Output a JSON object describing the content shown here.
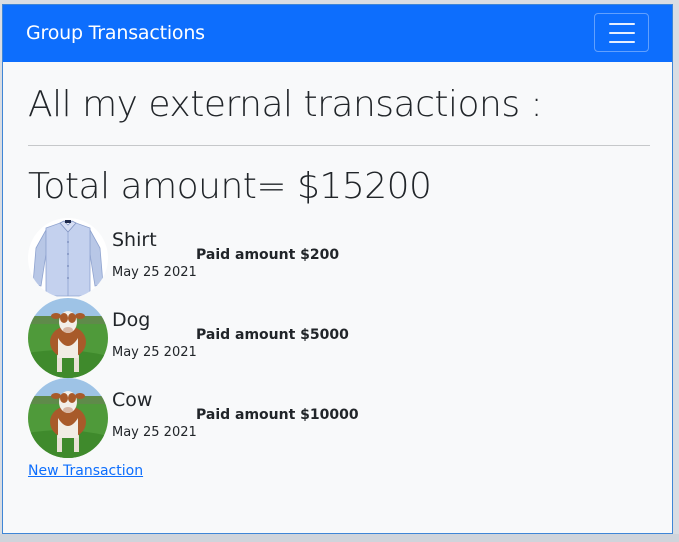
{
  "navbar": {
    "brand": "Group Transactions",
    "toggle_icon": "hamburger-menu-icon",
    "color": "#0d6efd"
  },
  "page": {
    "title": "All my external transactions :",
    "total": "Total amount= $15200"
  },
  "transactions": [
    {
      "name": "Shirt",
      "date": "May 25 2021",
      "paid": "Paid amount $200",
      "image": "shirt-photo"
    },
    {
      "name": "Dog",
      "date": "May 25 2021",
      "paid": "Paid amount $5000",
      "image": "cow-photo"
    },
    {
      "name": "Cow",
      "date": "May 25 2021",
      "paid": "Paid amount $10000",
      "image": "cow-photo"
    }
  ],
  "actions": {
    "new_transaction": "New Transaction"
  }
}
